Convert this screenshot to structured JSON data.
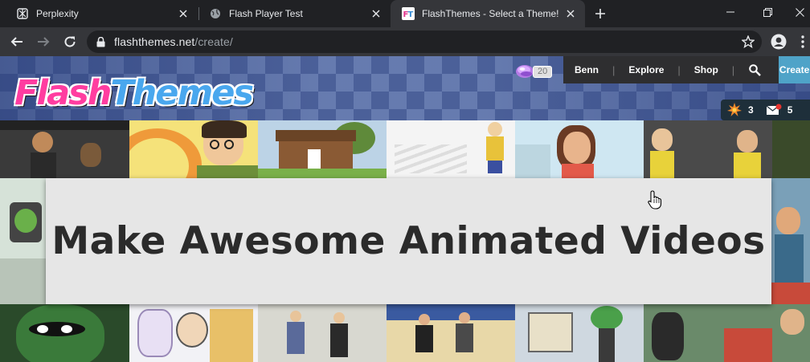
{
  "browser": {
    "tabs": [
      {
        "title": "Perplexity",
        "favicon": "perplexity-icon"
      },
      {
        "title": "Flash Player Test",
        "favicon": "globe-icon"
      },
      {
        "title": "FlashThemes - Select a Theme!",
        "favicon": "flashthemes-icon",
        "active": true
      }
    ],
    "url_host": "flashthemes.net",
    "url_path": "/create/"
  },
  "site": {
    "logo_part1": "Flash",
    "logo_part2": "Themes",
    "points": "20",
    "nav": {
      "user": "Benn",
      "explore": "Explore",
      "shop": "Shop",
      "create": "Create"
    },
    "notifications": {
      "alerts_count": "3",
      "messages_count": "5"
    },
    "hero_title": "Make Awesome Animated Videos"
  },
  "colors": {
    "create_button": "#4fa3c8",
    "nav_bar": "#2e2e30",
    "logo_pink": "#ff3da0",
    "logo_blue": "#49a7ee"
  }
}
